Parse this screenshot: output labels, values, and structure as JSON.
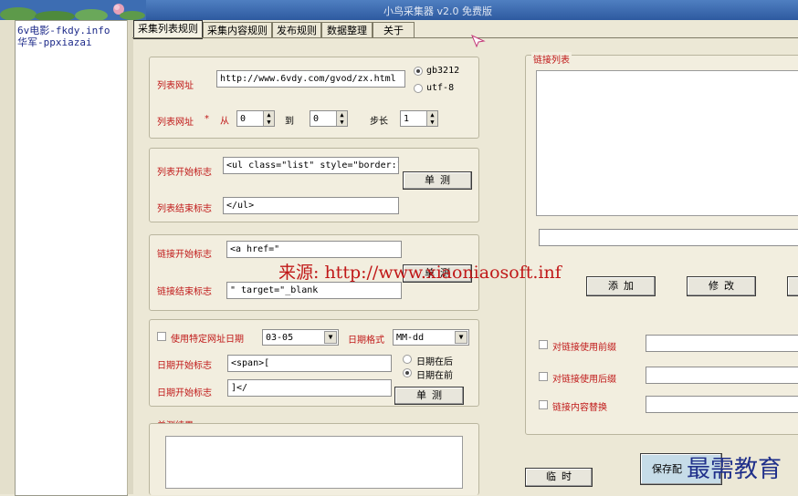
{
  "window": {
    "title": "小鸟采集器 v2.0 免费版"
  },
  "sites": [
    "6v电影-fkdy.info",
    "华军-ppxiazai"
  ],
  "tabs": [
    "采集列表规则",
    "采集内容规则",
    "发布规则",
    "数据整理",
    "关于"
  ],
  "list_rules": {
    "url_label": "列表网址",
    "url_value": "http://www.6vdy.com/gvod/zx.html",
    "enc1": "gb3212",
    "enc2": "utf-8",
    "range_label": "列表网址",
    "star": "*",
    "from_label": "从",
    "from_value": "0",
    "to_label": "到",
    "to_value": "0",
    "step_label": "步长",
    "step_value": "1",
    "start_label": "列表开始标志",
    "start_value": "<ul class=\"list\" style=\"border:1",
    "end_label": "列表结束标志",
    "end_value": "</ul>",
    "test_btn": "单测"
  },
  "link_rules": {
    "start_label": "链接开始标志",
    "start_value": "<a href=\"",
    "end_label": "链接结束标志",
    "end_value": "\" target=\"_blank",
    "test_btn": "单测"
  },
  "date_rules": {
    "use_date_label": "使用特定网址日期",
    "date_value": "03-05",
    "format_label": "日期格式",
    "format_value": "MM-dd",
    "start_label": "日期开始标志",
    "start_value": "<span>[",
    "end_label": "日期开始标志",
    "end_value": "]</",
    "after_label": "日期在后",
    "before_label": "日期在前",
    "test_btn": "单测"
  },
  "result": {
    "label": "单测结果"
  },
  "link_list": {
    "label": "链接列表",
    "add_btn": "添加",
    "edit_btn": "修改",
    "prefix_label": "对链接使用前缀",
    "suffix_label": "对链接使用后缀",
    "replace_label": "链接内容替换"
  },
  "footer": {
    "temp_btn": "临时",
    "save_btn": "保存配"
  },
  "overlays": {
    "watermark": "来源: http://www.xiaoniaosoft.inf",
    "corner": "最需教育"
  }
}
